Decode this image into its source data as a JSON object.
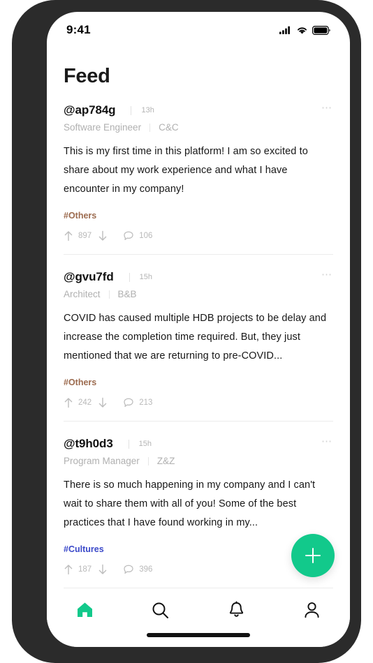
{
  "status_bar": {
    "time": "9:41",
    "signal_icon": "cellular-signal-icon",
    "wifi_icon": "wifi-icon",
    "battery_icon": "battery-full-icon"
  },
  "header": {
    "title": "Feed"
  },
  "colors": {
    "accent_green": "#12c98b",
    "tag_brown": "#9c6b4f",
    "tag_blue": "#3b49c9",
    "text_primary": "#171717",
    "text_muted": "#b0b0b0",
    "frame": "#2b2b2b"
  },
  "feed": {
    "posts": [
      {
        "handle": "@ap784g",
        "time": "13h",
        "role": "Software Engineer",
        "company": "C&C",
        "body": "This is my first time in this platform! I am so excited to share about my work experience and what I have encounter in my company!",
        "tag": "#Others",
        "tag_color": "#9c6b4f",
        "upvotes": "897",
        "comments": "106",
        "more_label": "⋯"
      },
      {
        "handle": "@gvu7fd",
        "time": "15h",
        "role": "Architect",
        "company": "B&B",
        "body": "COVID has caused multiple HDB projects to be delay and increase the completion time required. But, they just mentioned that we are returning to pre-COVID...",
        "tag": "#Others",
        "tag_color": "#9c6b4f",
        "upvotes": "242",
        "comments": "213",
        "more_label": "⋯"
      },
      {
        "handle": "@t9h0d3",
        "time": "15h",
        "role": "Program Manager",
        "company": "Z&Z",
        "body": "There is so much happening in my company and I can't wait to share them with all of you! Some of the best practices that I have found working in my...",
        "tag": "#Cultures",
        "tag_color": "#3b49c9",
        "upvotes": "187",
        "comments": "396",
        "more_label": "⋯"
      }
    ]
  },
  "fab": {
    "icon": "plus-icon",
    "label": "+"
  },
  "bottom_nav": {
    "items": [
      {
        "name": "home",
        "icon": "home-icon",
        "active": true
      },
      {
        "name": "search",
        "icon": "search-icon",
        "active": false
      },
      {
        "name": "notifications",
        "icon": "bell-icon",
        "active": false
      },
      {
        "name": "profile",
        "icon": "person-icon",
        "active": false
      }
    ]
  }
}
